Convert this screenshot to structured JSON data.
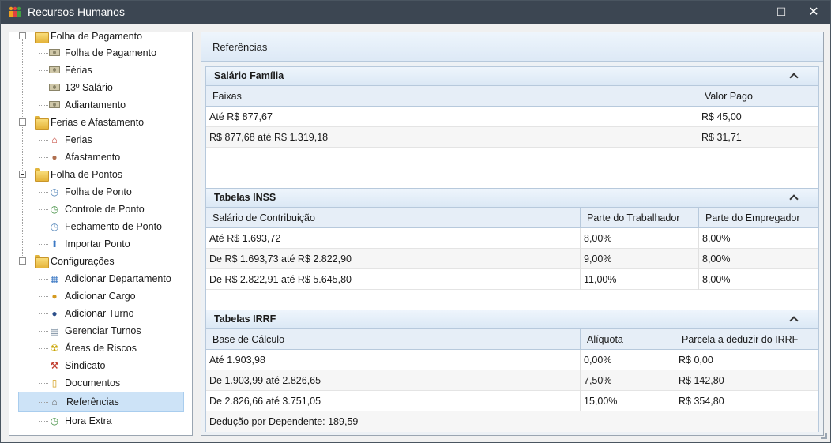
{
  "window": {
    "title": "Recursos Humanos",
    "minimize": "—",
    "maximize": "☐",
    "close": "✕"
  },
  "sidebar": {
    "groups": [
      {
        "label": "Folha de Pagamento",
        "items": [
          {
            "label": "Folha de Pagamento",
            "icon": "money-bill-icon"
          },
          {
            "label": "Férias",
            "icon": "money-bill-icon"
          },
          {
            "label": "13º Salário",
            "icon": "money-bill-icon"
          },
          {
            "label": "Adiantamento",
            "icon": "money-bill-icon"
          }
        ]
      },
      {
        "label": "Ferias e Afastamento",
        "items": [
          {
            "label": "Ferias",
            "icon": "house-icon"
          },
          {
            "label": "Afastamento",
            "icon": "person-icon"
          }
        ]
      },
      {
        "label": "Folha de Pontos",
        "items": [
          {
            "label": "Folha de Ponto",
            "icon": "clock-icon"
          },
          {
            "label": "Controle de Ponto",
            "icon": "clock-arrow-icon"
          },
          {
            "label": "Fechamento de Ponto",
            "icon": "clock-lock-icon"
          },
          {
            "label": "Importar Ponto",
            "icon": "upload-icon"
          }
        ]
      },
      {
        "label": "Configurações",
        "items": [
          {
            "label": "Adicionar Departamento",
            "icon": "building-icon"
          },
          {
            "label": "Adicionar Cargo",
            "icon": "worker-icon"
          },
          {
            "label": "Adicionar Turno",
            "icon": "worker-blue-icon"
          },
          {
            "label": "Gerenciar Turnos",
            "icon": "shifts-icon"
          },
          {
            "label": "Áreas de Riscos",
            "icon": "radiation-icon"
          },
          {
            "label": "Sindicato",
            "icon": "hammer-icon"
          },
          {
            "label": "Documentos",
            "icon": "documents-icon"
          },
          {
            "label": "Referências",
            "icon": "bank-icon"
          },
          {
            "label": "Hora Extra",
            "icon": "clock-plus-icon"
          }
        ]
      }
    ]
  },
  "panel": {
    "title": "Referências"
  },
  "salario_familia": {
    "title": "Salário Família",
    "columns": [
      "Faixas",
      "Valor Pago"
    ],
    "rows": [
      [
        "Até R$ 877,67",
        "R$ 45,00"
      ],
      [
        "R$ 877,68 até R$ 1.319,18",
        "R$ 31,71"
      ]
    ]
  },
  "inss": {
    "title": "Tabelas INSS",
    "columns": [
      "Salário de Contribuição",
      "Parte do Trabalhador",
      "Parte do Empregador"
    ],
    "rows": [
      [
        "Até R$ 1.693,72",
        "8,00%",
        "8,00%"
      ],
      [
        "De R$ 1.693,73 até R$ 2.822,90",
        "9,00%",
        "8,00%"
      ],
      [
        "De R$ 2.822,91 até R$ 5.645,80",
        "11,00%",
        "8,00%"
      ]
    ]
  },
  "irrf": {
    "title": "Tabelas IRRF",
    "columns": [
      "Base de Cálculo",
      "Alíquota",
      "Parcela a deduzir do IRRF"
    ],
    "rows": [
      [
        "Até 1.903,98",
        "0,00%",
        "R$ 0,00"
      ],
      [
        "De 1.903,99 até 2.826,65",
        "7,50%",
        "R$ 142,80"
      ],
      [
        "De 2.826,66 até 3.751,05",
        "15,00%",
        "R$ 354,80"
      ]
    ],
    "note": "Dedução por Dependente: 189,59"
  }
}
